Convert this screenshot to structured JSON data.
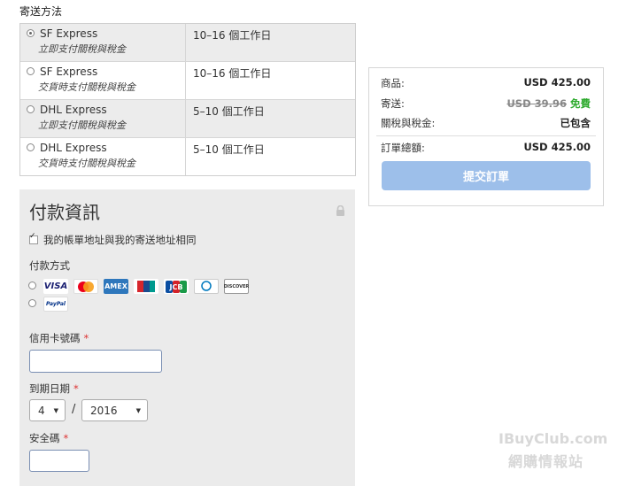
{
  "shipping": {
    "title": "寄送方法",
    "options": [
      {
        "carrier": "SF Express",
        "note": "立即支付關稅與稅金",
        "days": "10–16 個工作日",
        "selected": true
      },
      {
        "carrier": "SF Express",
        "note": "交貨時支付關稅與稅金",
        "days": "10–16 個工作日",
        "selected": false
      },
      {
        "carrier": "DHL Express",
        "note": "立即支付關稅與稅金",
        "days": "5–10 個工作日",
        "selected": false
      },
      {
        "carrier": "DHL Express",
        "note": "交貨時支付關稅與稅金",
        "days": "5–10 個工作日",
        "selected": false
      }
    ]
  },
  "summary": {
    "goods_label": "商品:",
    "goods_value": "USD 425.00",
    "shipping_label": "寄送:",
    "shipping_original": "USD 39.96",
    "shipping_free": "免費",
    "tax_label": "關稅與稅金:",
    "tax_value": "已包含",
    "total_label": "訂單總額:",
    "total_value": "USD 425.00",
    "submit_label": "提交訂單"
  },
  "payment": {
    "title": "付款資訊",
    "same_address_label": "我的帳單地址與我的寄送地址相同",
    "method_label": "付款方式",
    "card_number_label": "信用卡號碼",
    "expiry_label": "到期日期",
    "expiry_month": "4",
    "expiry_year": "2016",
    "expiry_separator": "/",
    "cvv_label": "安全碼",
    "required_mark": "*",
    "cards": [
      "VISA",
      "MasterCard",
      "AMEX",
      "UnionPay",
      "JCB",
      "Diners Club",
      "DISCOVER"
    ],
    "cards_text": {
      "visa": "VISA",
      "amex": "AMEX",
      "jcb": "JCB",
      "discover": "DISCOVER",
      "paypal": "PayPal"
    }
  },
  "watermark": {
    "line1": "IBuyClub.com",
    "line2": "網購情報站"
  },
  "colors": {
    "accent_button": "#9dbfea",
    "free_text": "#2eaa2e",
    "required": "#dd3333",
    "panel_bg": "#ebebeb"
  }
}
